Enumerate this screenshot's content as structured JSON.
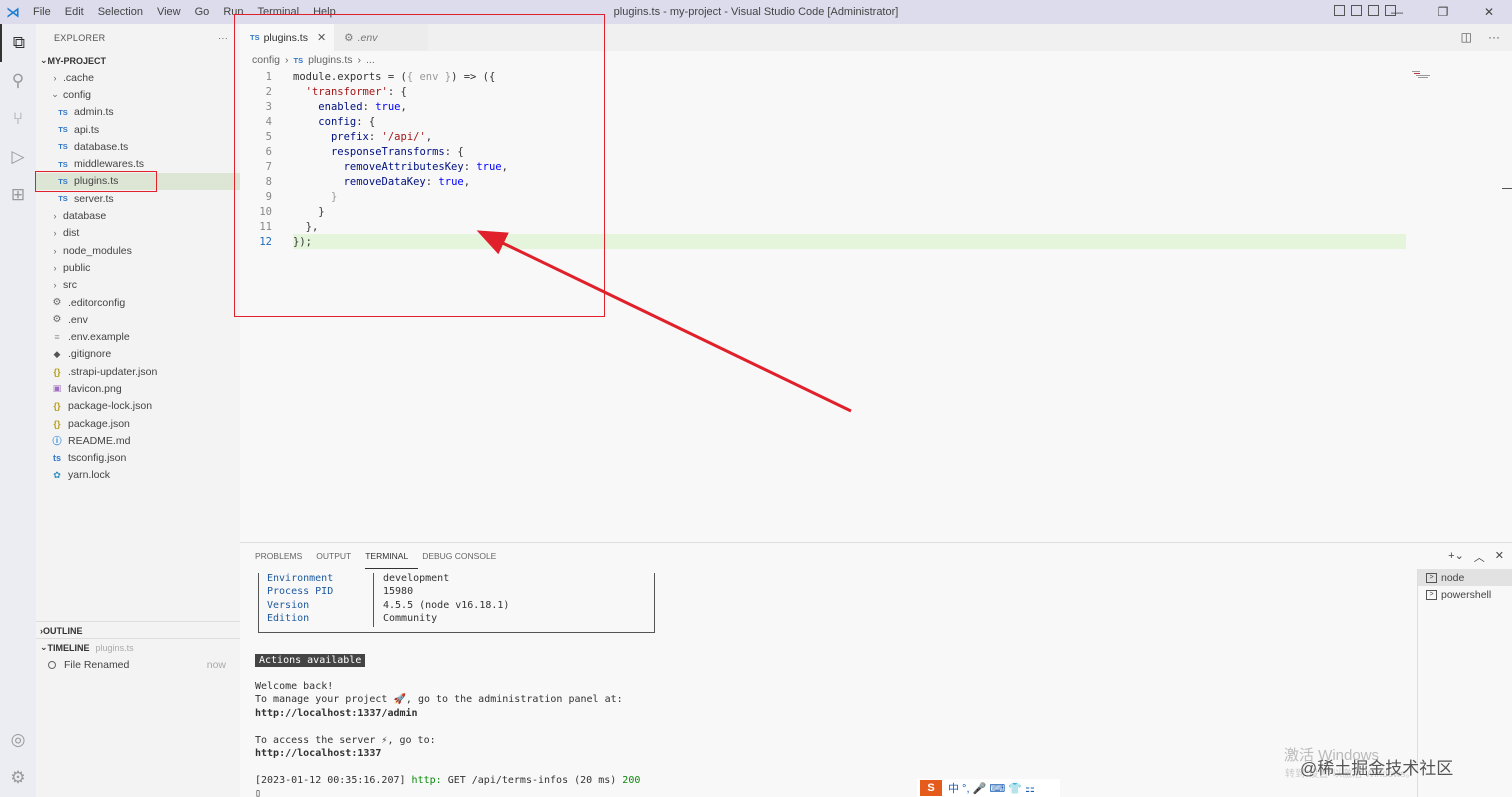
{
  "titlebar": {
    "menu": [
      "File",
      "Edit",
      "Selection",
      "View",
      "Go",
      "Run",
      "Terminal",
      "Help"
    ],
    "title": "plugins.ts - my-project - Visual Studio Code [Administrator]"
  },
  "sidebar": {
    "header": "EXPLORER",
    "project": "MY-PROJECT",
    "tree": [
      {
        "label": ".cache",
        "kind": "folder",
        "depth": 0,
        "open": false
      },
      {
        "label": "config",
        "kind": "folder",
        "depth": 0,
        "open": true
      },
      {
        "label": "admin.ts",
        "kind": "ts",
        "depth": 1
      },
      {
        "label": "api.ts",
        "kind": "ts",
        "depth": 1
      },
      {
        "label": "database.ts",
        "kind": "ts",
        "depth": 1
      },
      {
        "label": "middlewares.ts",
        "kind": "ts",
        "depth": 1
      },
      {
        "label": "plugins.ts",
        "kind": "ts",
        "depth": 1,
        "selected": true
      },
      {
        "label": "server.ts",
        "kind": "ts",
        "depth": 1
      },
      {
        "label": "database",
        "kind": "folder",
        "depth": 0,
        "open": false
      },
      {
        "label": "dist",
        "kind": "folder",
        "depth": 0,
        "open": false
      },
      {
        "label": "node_modules",
        "kind": "folder",
        "depth": 0,
        "open": false
      },
      {
        "label": "public",
        "kind": "folder",
        "depth": 0,
        "open": false
      },
      {
        "label": "src",
        "kind": "folder",
        "depth": 0,
        "open": false
      },
      {
        "label": ".editorconfig",
        "kind": "gear",
        "depth": 0
      },
      {
        "label": ".env",
        "kind": "gear",
        "depth": 0
      },
      {
        "label": ".env.example",
        "kind": "txt",
        "depth": 0
      },
      {
        "label": ".gitignore",
        "kind": "git",
        "depth": 0
      },
      {
        "label": ".strapi-updater.json",
        "kind": "json",
        "depth": 0
      },
      {
        "label": "favicon.png",
        "kind": "png",
        "depth": 0
      },
      {
        "label": "package-lock.json",
        "kind": "json",
        "depth": 0
      },
      {
        "label": "package.json",
        "kind": "json",
        "depth": 0
      },
      {
        "label": "README.md",
        "kind": "info",
        "depth": 0
      },
      {
        "label": "tsconfig.json",
        "kind": "tsconf",
        "depth": 0
      },
      {
        "label": "yarn.lock",
        "kind": "yarn",
        "depth": 0
      }
    ],
    "outline": "OUTLINE",
    "timeline": "TIMELINE",
    "timeline_file": "plugins.ts",
    "timeline_item": "File Renamed",
    "timeline_time": "now"
  },
  "editor": {
    "tabs": [
      {
        "label": "plugins.ts",
        "active": true
      },
      {
        "label": ".env",
        "active": false
      }
    ],
    "breadcrumb": {
      "folder": "config",
      "file": "plugins.ts",
      "more": "..."
    },
    "lines": [
      "1",
      "2",
      "3",
      "4",
      "5",
      "6",
      "7",
      "8",
      "9",
      "10",
      "11",
      "12"
    ]
  },
  "panel": {
    "tabs": [
      "PROBLEMS",
      "OUTPUT",
      "TERMINAL",
      "DEBUG CONSOLE"
    ],
    "active_tab": "TERMINAL",
    "table": [
      {
        "k": "Environment",
        "v": "development"
      },
      {
        "k": "Process PID",
        "v": "15980"
      },
      {
        "k": "Version",
        "v": "4.5.5 (node v16.18.1)"
      },
      {
        "k": "Edition",
        "v": "Community"
      }
    ],
    "actions_available": "Actions available",
    "welcome": "Welcome back!",
    "manage_line": "To manage your project 🚀, go to the administration panel at:",
    "admin_url": "http://localhost:1337/admin",
    "access_line": "To access the server ⚡, go to:",
    "server_url": "http://localhost:1337",
    "log_ts": "[2023-01-12 00:35:16.207]",
    "log_http": "http:",
    "log_req": "GET /api/terms-infos (20 ms)",
    "log_status": "200",
    "terminals": [
      "node",
      "powershell"
    ]
  },
  "overlay": {
    "watermark": "激活 Windows",
    "watermark_sub": "转到\"设置\"以激活 Windows。",
    "credit": "@稀土掘金技术社区",
    "ime": "中 °, 🎤 ⌨ 👕 ⚏"
  },
  "colors": {
    "annotation": "#e0202a",
    "accent": "#1b7fd6"
  }
}
